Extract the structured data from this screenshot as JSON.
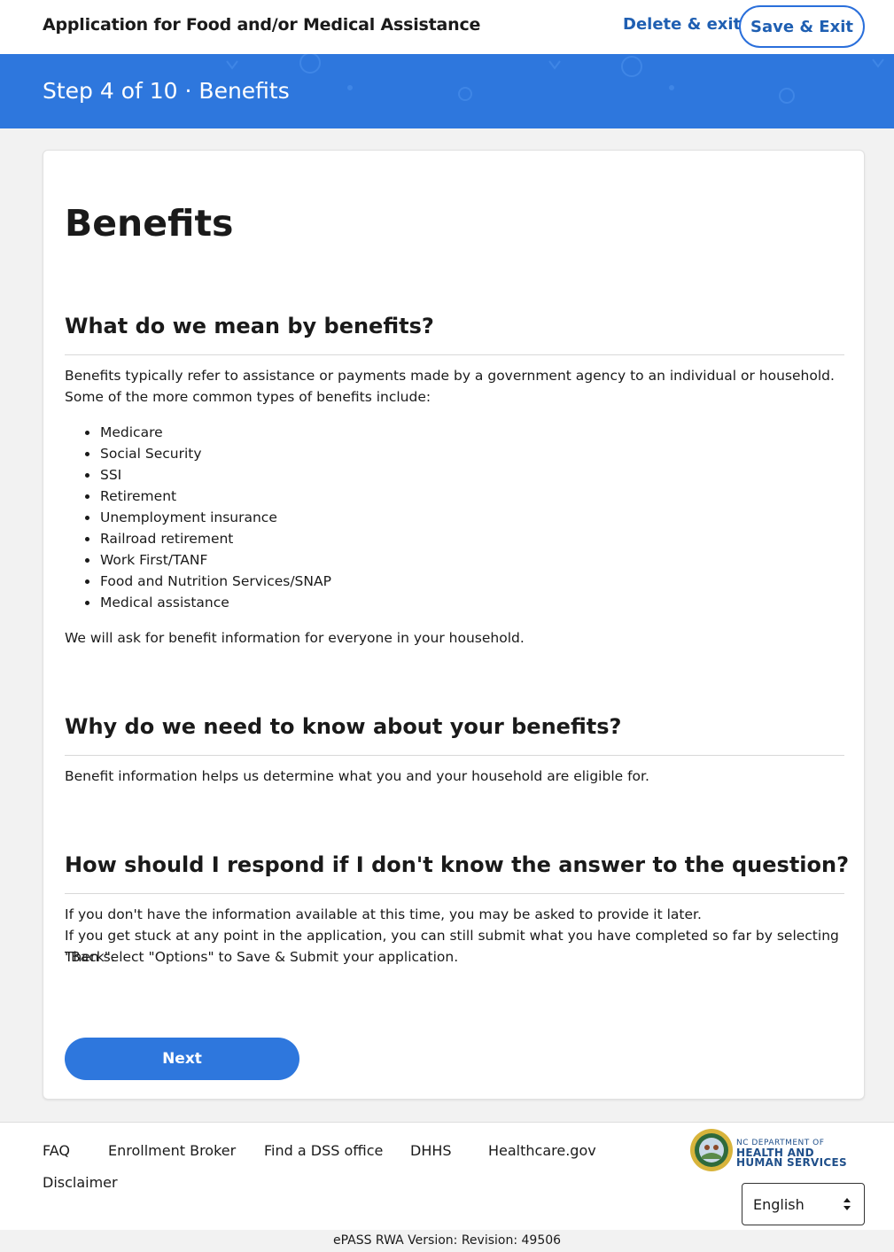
{
  "header": {
    "title": "Application for Food and/or Medical Assistance",
    "delete_exit": "Delete & exit",
    "save_exit": "Save & Exit"
  },
  "step": {
    "label": "Step 4 of 10 · Benefits"
  },
  "content": {
    "title": "Benefits",
    "sections": [
      {
        "heading": "What do we mean by benefits?",
        "intro": "Benefits typically refer to assistance or payments made by a government agency to an individual or household. Some of the more common types of benefits include:",
        "items": [
          "Medicare",
          "Social Security",
          "SSI",
          "Retirement",
          "Unemployment insurance",
          "Railroad retirement",
          "Work First/TANF",
          "Food and Nutrition Services/SNAP",
          "Medical assistance"
        ],
        "outro": "We will ask for benefit information for everyone in your household."
      },
      {
        "heading": "Why do we need to know about your benefits?",
        "text": "Benefit information helps us determine what you and your household are eligible for."
      },
      {
        "heading": "How should I respond if I don't know the answer to the question?",
        "lines": [
          "If you don't have the information available at this time, you may be asked to provide it later.",
          "If you get stuck at any point in the application, you can still submit what you have completed so far by selecting \"Back\".",
          "Then select \"Options\" to Save & Submit your application."
        ]
      }
    ],
    "next_button": "Next"
  },
  "footer": {
    "links": [
      "FAQ",
      "Enrollment Broker",
      "Find a DSS office",
      "DHHS",
      "Healthcare.gov",
      "Disclaimer"
    ],
    "dept_line1": "NC DEPARTMENT OF",
    "dept_line2": "HEALTH AND",
    "dept_line3": "HUMAN SERVICES",
    "language": "English"
  },
  "version": "ePASS RWA Version: Revision: 49506",
  "colors": {
    "primary": "#2e77dd",
    "link": "#1f5fb2",
    "background": "#f2f2f2"
  }
}
